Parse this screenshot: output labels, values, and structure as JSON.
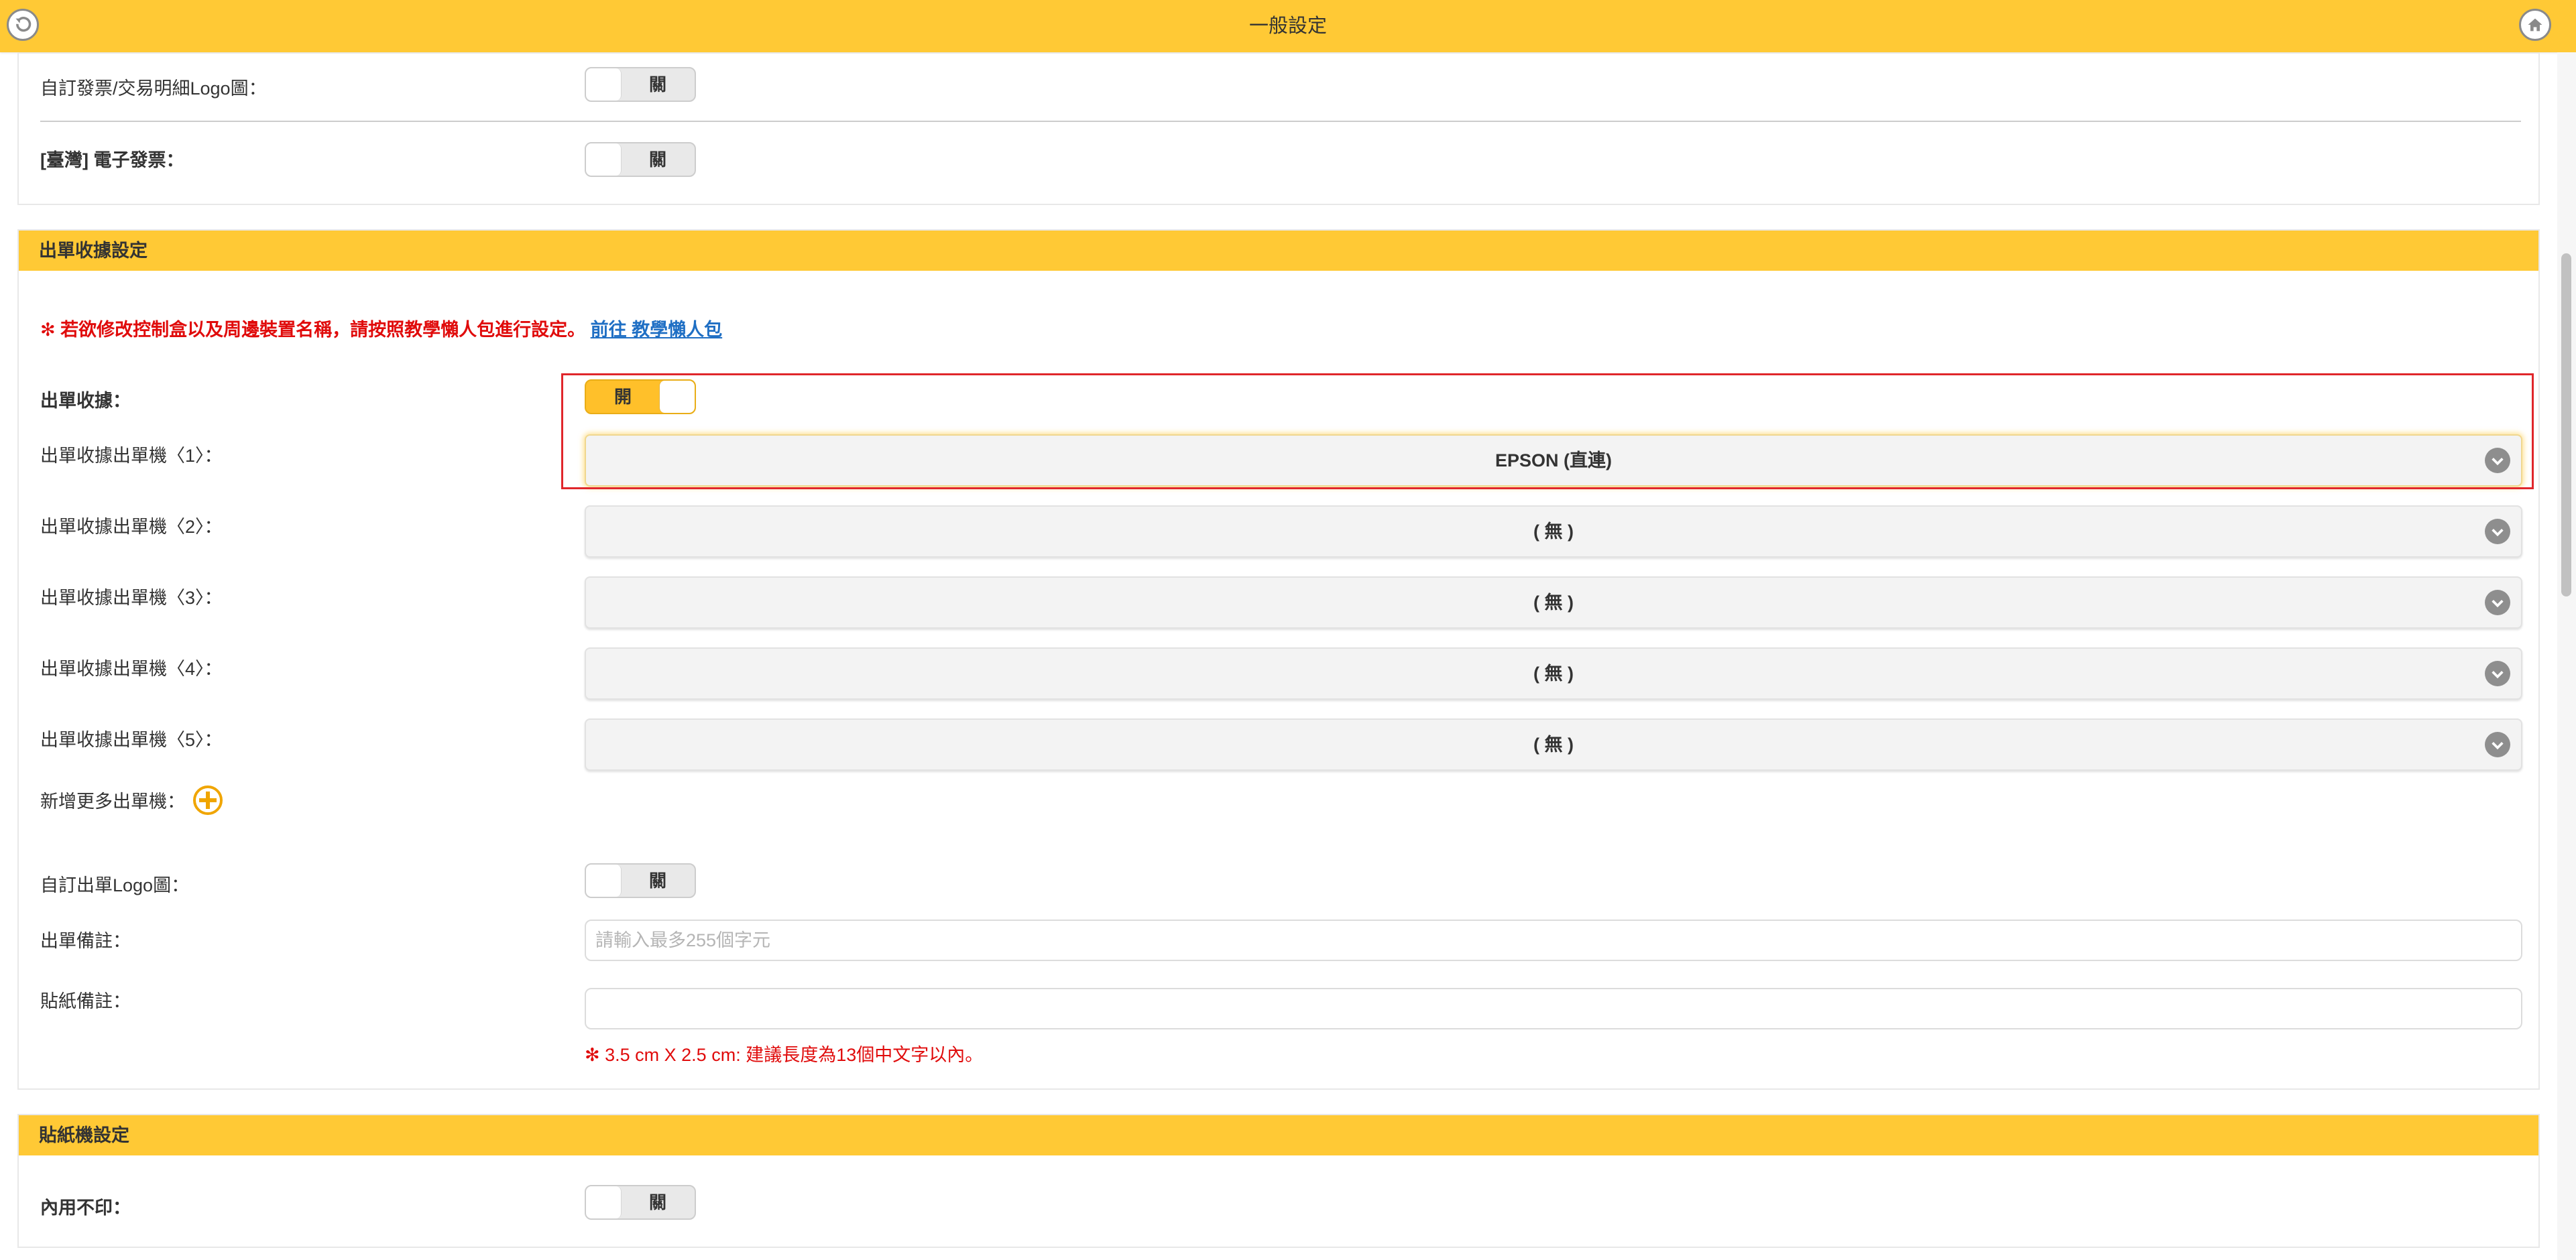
{
  "header": {
    "title": "一般設定"
  },
  "top_section": {
    "rows": [
      {
        "label": "自訂發票/交易明細Logo圖：",
        "toggle": "關"
      },
      {
        "label": "[臺灣] 電子發票：",
        "toggle": "關"
      }
    ]
  },
  "receipt_section": {
    "title": "出單收據設定",
    "notice": "✻ 若欲修改控制盒以及周邊裝置名稱，請按照教學懶人包進行設定。",
    "notice_link": "前往 教學懶人包",
    "receipt_toggle_label": "出單收據：",
    "receipt_toggle": "開",
    "printers": [
      {
        "label": "出單收據出單機〈1〉：",
        "value": "EPSON (直連)"
      },
      {
        "label": "出單收據出單機〈2〉：",
        "value": "( 無 )"
      },
      {
        "label": "出單收據出單機〈3〉：",
        "value": "( 無 )"
      },
      {
        "label": "出單收據出單機〈4〉：",
        "value": "( 無 )"
      },
      {
        "label": "出單收據出單機〈5〉：",
        "value": "( 無 )"
      }
    ],
    "add_more_label": "新增更多出單機：",
    "logo_label": "自訂出單Logo圖：",
    "logo_toggle": "關",
    "note_label": "出單備註：",
    "note_placeholder": "請輸入最多255個字元",
    "sticker_note_label": "貼紙備註：",
    "sticker_note_value": "",
    "sticker_hint": "✻ 3.5 cm X 2.5 cm: 建議長度為13個中文字以內。"
  },
  "sticker_section": {
    "title": "貼紙機設定",
    "dine_in_label": "內用不印：",
    "dine_in_toggle": "關"
  },
  "colors": {
    "accent": "#ffc935",
    "warning": "#e00b0b",
    "link": "#1f6fc4",
    "highlight_border": "#e0262b"
  },
  "icons": {
    "back": "back-arrow-icon",
    "home": "home-icon",
    "chevron": "chevron-down-icon",
    "add": "plus-circle-icon"
  }
}
